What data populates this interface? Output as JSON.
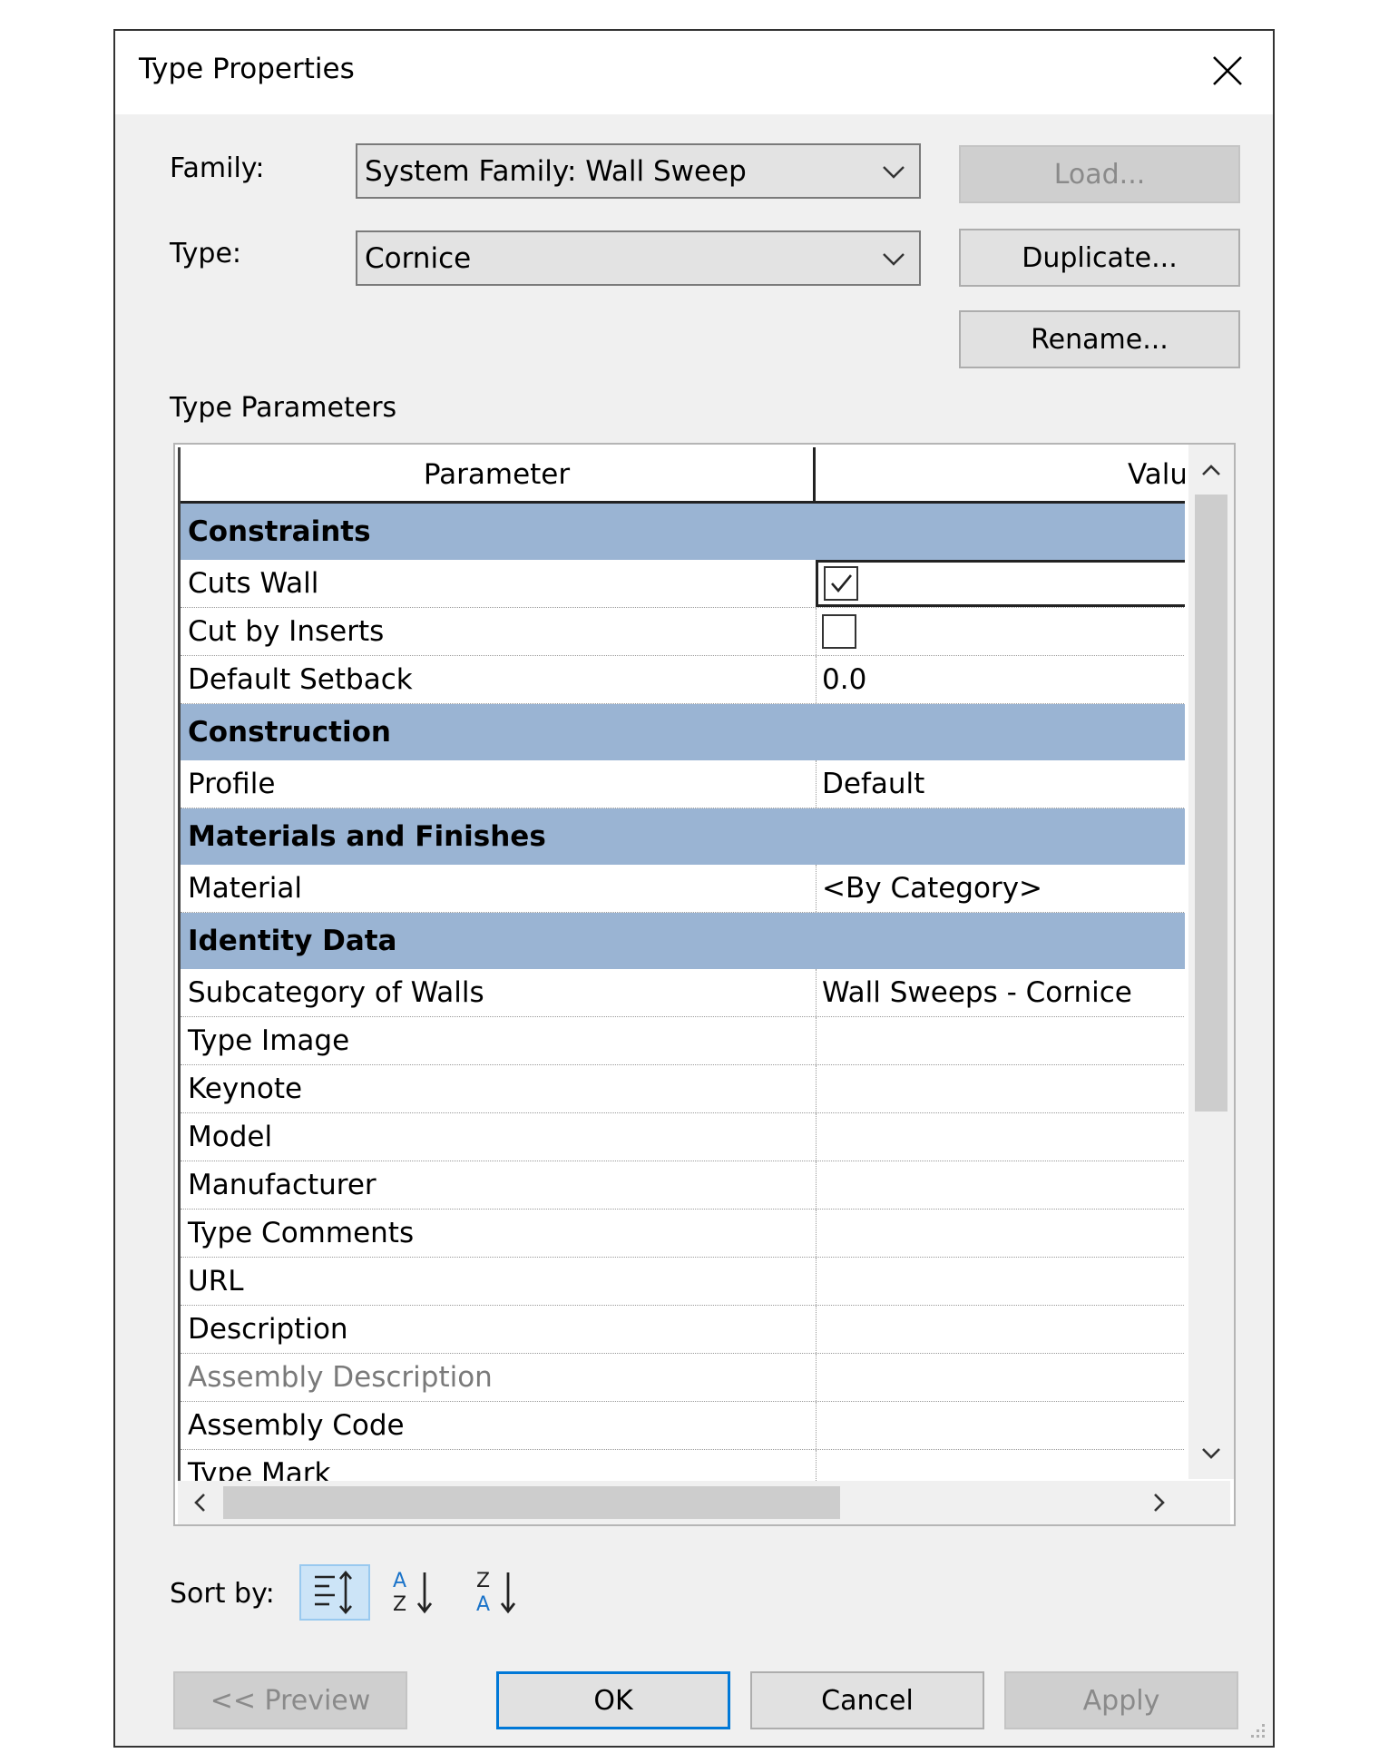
{
  "window": {
    "title": "Type Properties"
  },
  "family": {
    "label": "Family:",
    "value": "System Family: Wall Sweep"
  },
  "type": {
    "label": "Type:",
    "value": "Cornice"
  },
  "buttons": {
    "load": "Load...",
    "duplicate": "Duplicate...",
    "rename": "Rename...",
    "preview": "<< Preview",
    "ok": "OK",
    "cancel": "Cancel",
    "apply": "Apply"
  },
  "section_label": "Type Parameters",
  "grid": {
    "header_parameter": "Parameter",
    "header_value": "Valu",
    "groups": [
      {
        "name": "Constraints",
        "rows": [
          {
            "param": "Cuts Wall",
            "kind": "checkbox",
            "checked": true
          },
          {
            "param": "Cut by Inserts",
            "kind": "checkbox",
            "checked": false
          },
          {
            "param": "Default Setback",
            "value": "0.0"
          }
        ]
      },
      {
        "name": "Construction",
        "rows": [
          {
            "param": "Profile",
            "value": "Default"
          }
        ]
      },
      {
        "name": "Materials and Finishes",
        "rows": [
          {
            "param": "Material",
            "value": "<By Category>"
          }
        ]
      },
      {
        "name": "Identity Data",
        "rows": [
          {
            "param": "Subcategory of Walls",
            "value": "Wall Sweeps - Cornice"
          },
          {
            "param": "Type Image",
            "value": ""
          },
          {
            "param": "Keynote",
            "value": ""
          },
          {
            "param": "Model",
            "value": ""
          },
          {
            "param": "Manufacturer",
            "value": ""
          },
          {
            "param": "Type Comments",
            "value": ""
          },
          {
            "param": "URL",
            "value": ""
          },
          {
            "param": "Description",
            "value": ""
          },
          {
            "param": "Assembly Description",
            "value": "",
            "dim": true
          },
          {
            "param": "Assembly Code",
            "value": ""
          },
          {
            "param": "Type Mark",
            "value": ""
          }
        ]
      }
    ]
  },
  "sort": {
    "label": "Sort by:",
    "options": [
      "group-icon",
      "sort-az-icon",
      "sort-za-icon"
    ],
    "active": "group-icon"
  },
  "colors": {
    "group_header": "#9ab4d3",
    "accent": "#0078d7",
    "sort_active": "#cce4f7"
  }
}
